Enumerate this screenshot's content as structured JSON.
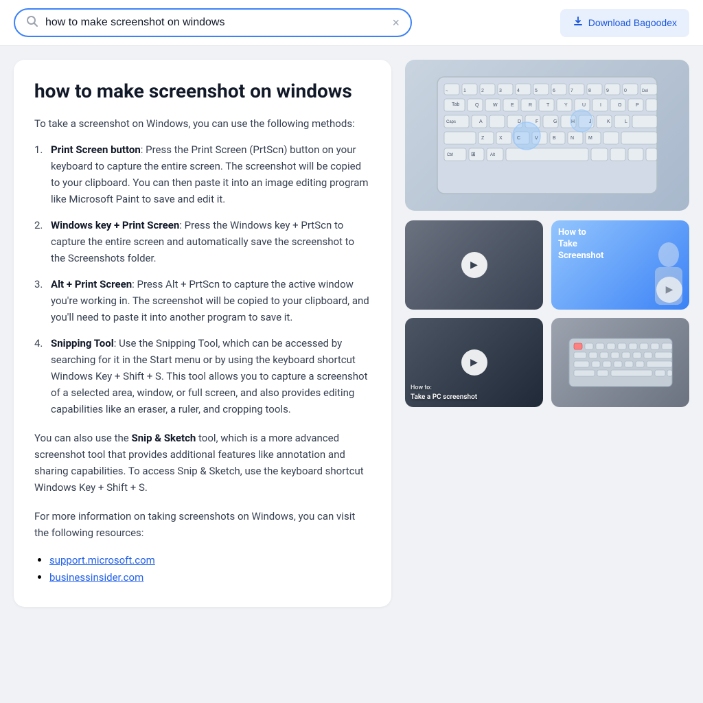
{
  "header": {
    "search_query": "how to make screenshot on windows",
    "search_placeholder": "Search...",
    "clear_label": "×",
    "download_button_label": "Download Bagoodex",
    "download_icon": "⬇"
  },
  "answer": {
    "title": "how to make screenshot on windows",
    "intro": "To take a screenshot on Windows, you can use the following methods:",
    "methods": [
      {
        "num": "1.",
        "bold": "Print Screen button",
        "text": ": Press the Print Screen (PrtScn) button on your keyboard to capture the entire screen. The screenshot will be copied to your clipboard. You can then paste it into an image editing program like Microsoft Paint to save and edit it."
      },
      {
        "num": "2.",
        "bold": "Windows key + Print Screen",
        "text": ": Press the Windows key + PrtScn to capture the entire screen and automatically save the screenshot to the Screenshots folder."
      },
      {
        "num": "3.",
        "bold": "Alt + Print Screen",
        "text": ": Press Alt + PrtScn to capture the active window you're working in. The screenshot will be copied to your clipboard, and you'll need to paste it into another program to save it."
      },
      {
        "num": "4.",
        "bold": "Snipping Tool",
        "text": ": Use the Snipping Tool, which can be accessed by searching for it in the Start menu or by using the keyboard shortcut Windows Key + Shift + S. This tool allows you to capture a screenshot of a selected area, window, or full screen, and also provides editing capabilities like an eraser, a ruler, and cropping tools."
      }
    ],
    "paragraph1_start": "You can also use the ",
    "paragraph1_bold": "Snip & Sketch",
    "paragraph1_end": " tool, which is a more advanced screenshot tool that provides additional features like annotation and sharing capabilities. To access Snip & Sketch, use the keyboard shortcut Windows Key + Shift + S.",
    "paragraph2": "For more information on taking screenshots on Windows, you can visit the following resources:",
    "resources": [
      {
        "label": "support.microsoft.com",
        "url": "#"
      },
      {
        "label": "businessinsider.com",
        "url": "#"
      }
    ]
  },
  "videos": [
    {
      "id": 1,
      "label": "",
      "style": "dark",
      "has_play": true,
      "title_overlay": ""
    },
    {
      "id": 2,
      "label": "How to Take Screenshot",
      "style": "blue",
      "has_play": true,
      "title_overlay": "How to\nTake\nScreenshot"
    },
    {
      "id": 3,
      "label": "How to: Take a PC screenshot",
      "style": "dark2",
      "has_play": true,
      "title_overlay": ""
    },
    {
      "id": 4,
      "label": "",
      "style": "gray",
      "has_play": false,
      "title_overlay": ""
    }
  ],
  "icons": {
    "search": "🔍",
    "play": "▶"
  }
}
